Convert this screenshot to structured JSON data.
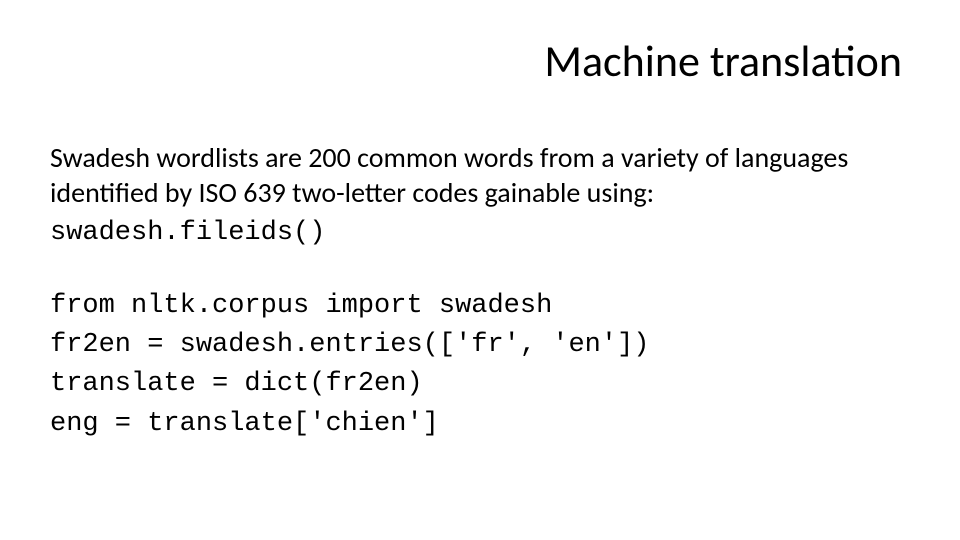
{
  "title": "Machine translation",
  "intro": "Swadesh wordlists are 200 common words from a variety of languages identified by ISO 639 two-letter codes gainable using:",
  "snippet1": "swadesh.fileids()",
  "code": {
    "l1": "from nltk.corpus import swadesh",
    "l2": "fr2en = swadesh.entries(['fr', 'en'])",
    "l3": "translate = dict(fr2en)",
    "l4": "eng = translate['chien']"
  }
}
